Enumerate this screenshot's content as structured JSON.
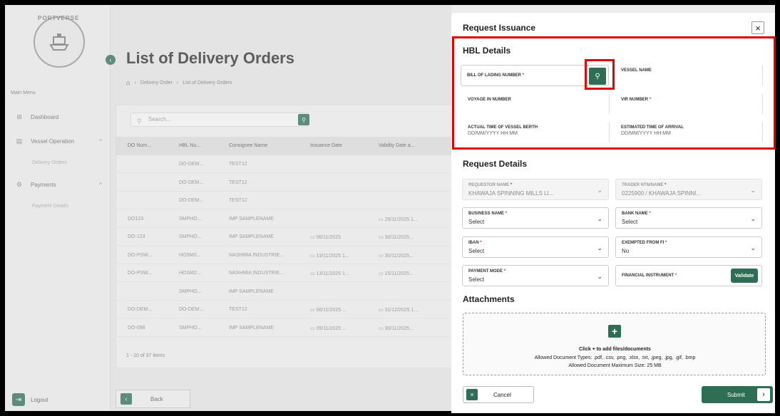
{
  "app": {
    "logo_text": "PORTVERSE",
    "main_menu_label": "Main Menu"
  },
  "sidebar": {
    "items": [
      {
        "label": "Dashboard",
        "icon": "grid-icon"
      },
      {
        "label": "Vessel Operation",
        "icon": "calendar-icon"
      },
      {
        "label": "Payments",
        "icon": "gear-icon"
      }
    ],
    "subitems": {
      "vessel": "Delivery Orders",
      "payments": "Payment Details"
    },
    "logout": "Logout"
  },
  "page": {
    "title": "List of Delivery Orders",
    "breadcrumb": [
      "Delivery Order",
      "List of Delivery Orders"
    ],
    "search_placeholder": "Search...",
    "columns": [
      "DO Num...",
      "HBL Nu...",
      "Consignee Name",
      "Issuance Date",
      "Validity Date a..."
    ],
    "rows": [
      [
        "",
        "DO-DEM...",
        "TEST12",
        "",
        ""
      ],
      [
        "",
        "DO-DEM...",
        "TEST12",
        "",
        ""
      ],
      [
        "",
        "DO-DEM...",
        "TEST12",
        "",
        ""
      ],
      [
        "DO123",
        "SMPHO...",
        "IMP SAMPLENAME",
        "",
        "29/11/2025 1..."
      ],
      [
        "DO-123",
        "SMPHO...",
        "IMP SAMPLENAME",
        "06/11/2025",
        "30/11/2025..."
      ],
      [
        "DO-PSW...",
        "HOSM2...",
        "NASHMIA INDUSTRIE...",
        "13/11/2025 1...",
        "30/11/2025..."
      ],
      [
        "DO-PSW...",
        "HOSM2...",
        "NASHMIA INDUSTRIE...",
        "13/11/2025 1...",
        "15/11/2025..."
      ],
      [
        "",
        "SMPHO...",
        "IMP SAMPLENAME",
        "",
        ""
      ],
      [
        "DO-DEM...",
        "DO-DEM...",
        "TEST12",
        "06/11/2025 ...",
        "31/12/2025 1..."
      ],
      [
        "DO-098",
        "SMPHO...",
        "IMP SAMPLENAME",
        "05/11/2025 ...",
        "30/11/2025..."
      ]
    ],
    "pager": "1 - 10 of 37 items",
    "back": "Back"
  },
  "modal": {
    "title": "Request Issuance",
    "hbl_section": "HBL Details",
    "hbl": {
      "bl_label": "BILL OF LADING NUMBER",
      "vessel_label": "VESSEL NAME",
      "voyage_label": "VOYAGE IN NUMBER",
      "vir_label": "VIR NUMBER",
      "atb_label": "ACTUAL TIME OF VESSEL BERTH",
      "atb_value": "DD/MM/YYYY HH:MM",
      "eta_label": "ESTIMATED TIME OF ARRIVAL",
      "eta_value": "DD/MM/YYYY HH:MM"
    },
    "request_section": "Request Details",
    "request": {
      "requestor_label": "REQUESTOR NAME",
      "requestor_value": "KHAWAJA SPINNING MILLS LI...",
      "trader_label": "TRADER NTN/NAME",
      "trader_value": "0225900 / KHAWAJA SPINNI...",
      "business_label": "BUSINESS NAME",
      "business_value": "Select",
      "bank_label": "BANK NAME",
      "bank_value": "Select",
      "iban_label": "IBAN",
      "iban_value": "Select",
      "exempted_label": "EXEMPTED FROM FI",
      "exempted_value": "No",
      "payment_label": "PAYMENT MODE",
      "payment_value": "Select",
      "fi_label": "FINANCIAL INSTRUMENT",
      "validate": "Validate"
    },
    "attachments_section": "Attachments",
    "dropzone": {
      "line1": "Click + to add files/documents",
      "line2": "Allowed Document Types: .pdf, .csv, .png, .xlsx, .txt, .jpeg, .jpg, .gif, .bmp",
      "line3": "Allowed Document Maximum Size: 25 MB"
    },
    "cancel": "Cancel",
    "submit": "Submit"
  },
  "colors": {
    "brand": "#2e6e55",
    "highlight": "#e10000"
  }
}
